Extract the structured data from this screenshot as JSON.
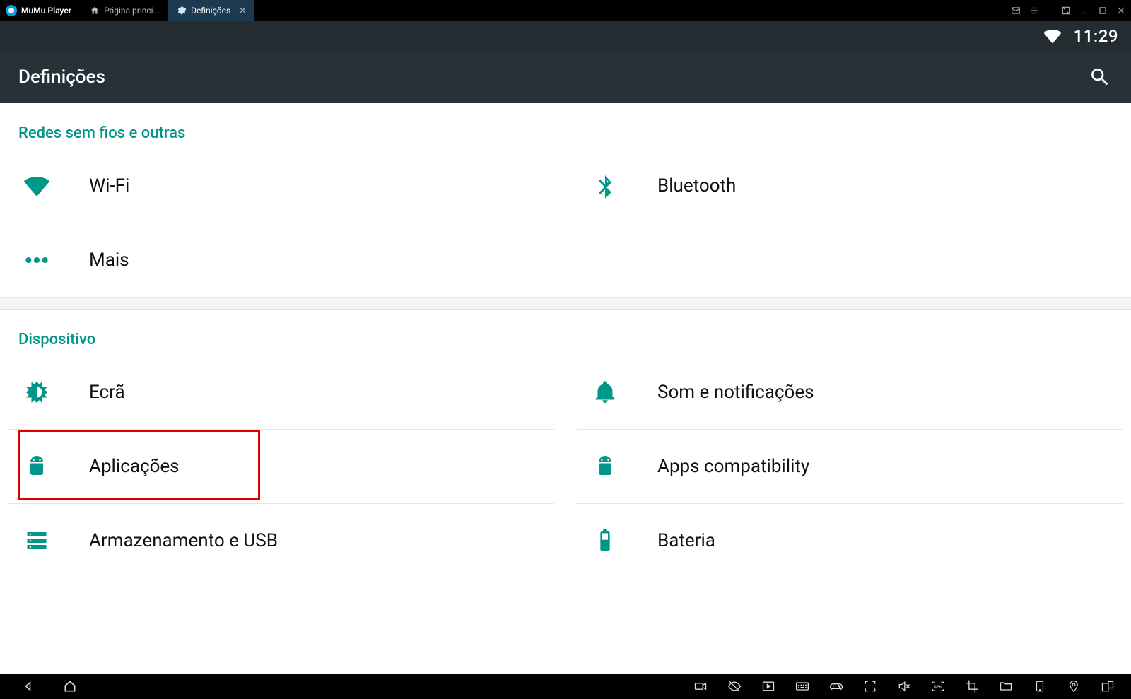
{
  "window": {
    "brand": "MuMu Player",
    "tabs": [
      {
        "label": "Página princi...",
        "icon": "home-icon",
        "active": false
      },
      {
        "label": "Definições",
        "icon": "gear-icon",
        "active": true
      }
    ],
    "controls": [
      "mail-icon",
      "menu-icon",
      "fullscreen-toggle-icon",
      "minimize-icon",
      "maximize-icon",
      "close-icon"
    ]
  },
  "status_bar": {
    "clock": "11:29"
  },
  "app_bar": {
    "title": "Definições"
  },
  "sections": [
    {
      "title": "Redes sem fios e outras",
      "rows": [
        {
          "left": {
            "icon": "wifi-icon",
            "label": "Wi-Fi"
          },
          "right": {
            "icon": "bluetooth-icon",
            "label": "Bluetooth"
          }
        },
        {
          "left": {
            "icon": "more-dots-icon",
            "label": "Mais"
          },
          "right": null
        }
      ]
    },
    {
      "title": "Dispositivo",
      "rows": [
        {
          "left": {
            "icon": "display-icon",
            "label": "Ecrã"
          },
          "right": {
            "icon": "bell-icon",
            "label": "Som e notificações"
          }
        },
        {
          "left": {
            "icon": "android-icon",
            "label": "Aplicações",
            "highlighted": true
          },
          "right": {
            "icon": "android-icon",
            "label": "Apps compatibility"
          }
        },
        {
          "left": {
            "icon": "storage-icon",
            "label": "Armazenamento e USB"
          },
          "right": {
            "icon": "battery-icon",
            "label": "Bateria"
          }
        }
      ]
    }
  ],
  "navbar_left": [
    "back-icon",
    "home-icon"
  ],
  "navbar_right": [
    "record-icon",
    "eye-off-icon",
    "play-window-icon",
    "keyboard-icon",
    "gamepad-icon",
    "focus-icon",
    "mute-icon",
    "apk-icon",
    "crop-icon",
    "folder-icon",
    "tablet-icon",
    "location-icon",
    "multi-window-icon"
  ],
  "colors": {
    "accent": "#009688"
  }
}
